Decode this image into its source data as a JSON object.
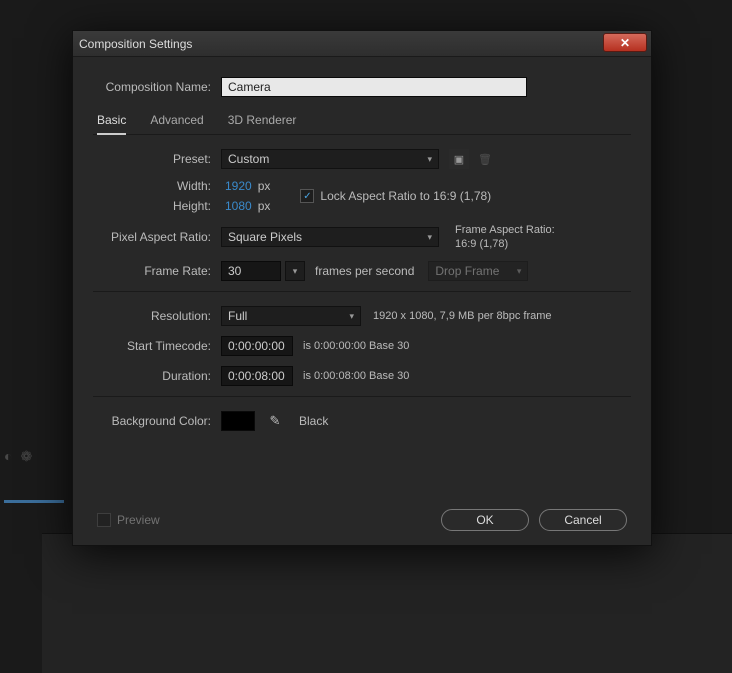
{
  "dialog": {
    "title": "Composition Settings",
    "compNameLabel": "Composition Name:",
    "compName": "Camera",
    "tabs": {
      "basic": "Basic",
      "advanced": "Advanced",
      "renderer": "3D Renderer"
    },
    "preset": {
      "label": "Preset:",
      "value": "Custom"
    },
    "width": {
      "label": "Width:",
      "value": "1920",
      "unit": "px"
    },
    "height": {
      "label": "Height:",
      "value": "1080",
      "unit": "px"
    },
    "lockAspect": "Lock Aspect Ratio to 16:9 (1,78)",
    "par": {
      "label": "Pixel Aspect Ratio:",
      "value": "Square Pixels"
    },
    "parInfo": {
      "line1": "Frame Aspect Ratio:",
      "line2": "16:9 (1,78)"
    },
    "frameRate": {
      "label": "Frame Rate:",
      "value": "30",
      "unitLabel": "frames per second",
      "dropFrame": "Drop Frame"
    },
    "resolution": {
      "label": "Resolution:",
      "value": "Full",
      "info": "1920 x 1080, 7,9 MB per 8bpc frame"
    },
    "startTC": {
      "label": "Start Timecode:",
      "value": "0:00:00:00",
      "note": "is 0:00:00:00  Base 30"
    },
    "duration": {
      "label": "Duration:",
      "value": "0:00:08:00",
      "note": "is 0:00:08:00  Base 30"
    },
    "bgColor": {
      "label": "Background Color:",
      "name": "Black"
    },
    "preview": "Preview",
    "ok": "OK",
    "cancel": "Cancel"
  }
}
